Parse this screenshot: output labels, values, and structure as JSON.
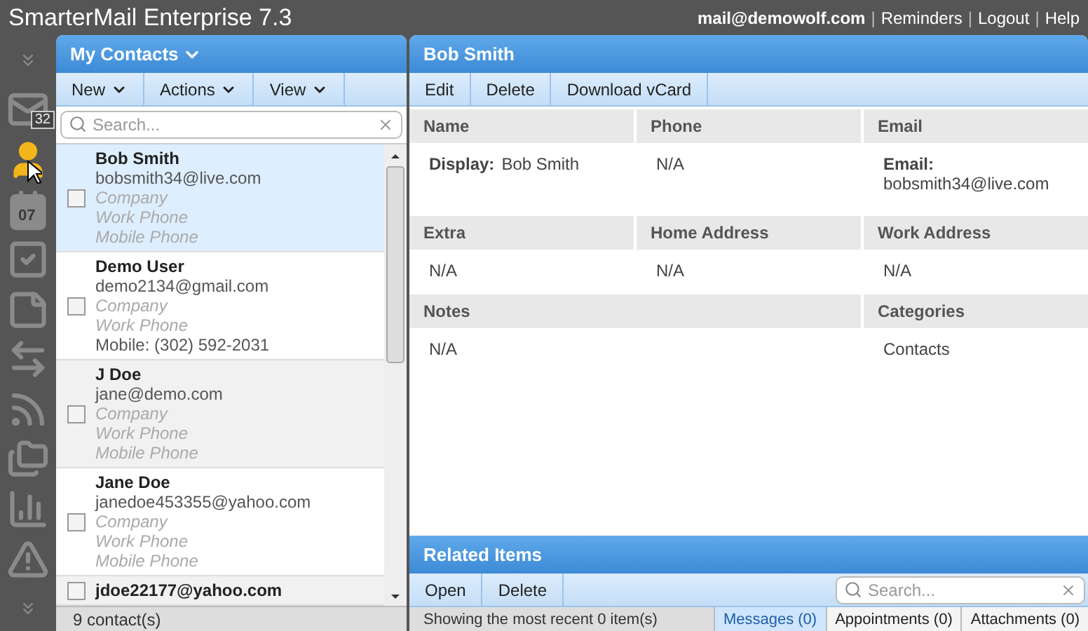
{
  "app_title": "SmarterMail Enterprise 7.3",
  "top_links": [
    {
      "text": "mail@demowolf.com",
      "kind": "account"
    },
    {
      "text": "|",
      "kind": "separator"
    },
    {
      "text": "Reminders",
      "kind": "link"
    },
    {
      "text": "|",
      "kind": "separator"
    },
    {
      "text": "Logout",
      "kind": "link"
    },
    {
      "text": "|",
      "kind": "separator"
    },
    {
      "text": "Help",
      "kind": "link"
    }
  ],
  "nav": [
    {
      "kind": "collapse"
    },
    {
      "kind": "mail",
      "badge": "32",
      "selected": false
    },
    {
      "kind": "contacts",
      "selected": true
    },
    {
      "kind": "calendar",
      "day": "07",
      "selected": false
    },
    {
      "kind": "tasks",
      "selected": false
    },
    {
      "kind": "notes",
      "selected": false
    },
    {
      "kind": "sync",
      "selected": false
    },
    {
      "kind": "feeds",
      "selected": false
    },
    {
      "kind": "files",
      "selected": false
    },
    {
      "kind": "reports",
      "selected": false
    },
    {
      "kind": "alerts",
      "selected": false
    },
    {
      "kind": "collapse"
    }
  ],
  "contacts_panel": {
    "title": "My Contacts",
    "menus": [
      "New",
      "Actions",
      "View"
    ],
    "search": {
      "placeholder": "Search..."
    },
    "contacts": [
      {
        "name": "Bob Smith",
        "selected": true,
        "checked": false,
        "lines": [
          {
            "text": "bobsmith34@live.com",
            "empty": false
          },
          {
            "text": "Company",
            "empty": true
          },
          {
            "text": "Work Phone",
            "empty": true
          },
          {
            "text": "Mobile Phone",
            "empty": true
          }
        ]
      },
      {
        "name": "Demo User",
        "selected": false,
        "checked": false,
        "lines": [
          {
            "text": "demo2134@gmail.com",
            "empty": false
          },
          {
            "text": "Company",
            "empty": true
          },
          {
            "text": "Work Phone",
            "empty": true
          },
          {
            "text": "Mobile: (302) 592-2031",
            "empty": false
          }
        ]
      },
      {
        "name": "J Doe",
        "selected": false,
        "checked": false,
        "lines": [
          {
            "text": "jane@demo.com",
            "empty": false
          },
          {
            "text": "Company",
            "empty": true
          },
          {
            "text": "Work Phone",
            "empty": true
          },
          {
            "text": "Mobile Phone",
            "empty": true
          }
        ]
      },
      {
        "name": "Jane Doe",
        "selected": false,
        "checked": false,
        "lines": [
          {
            "text": "janedoe453355@yahoo.com",
            "empty": false
          },
          {
            "text": "Company",
            "empty": true
          },
          {
            "text": "Work Phone",
            "empty": true
          },
          {
            "text": "Mobile Phone",
            "empty": true
          }
        ]
      },
      {
        "name": "jdoe22177@yahoo.com",
        "selected": false,
        "checked": false
      }
    ],
    "count": "9 contact(s)"
  },
  "detail": {
    "title": "Bob Smith",
    "actions": [
      "Edit",
      "Delete",
      "Download vCard"
    ],
    "rows": [
      [
        {
          "heading": "Name",
          "items": [
            {
              "label": "Display:",
              "value": "Bob Smith",
              "kind": "inline"
            }
          ]
        },
        {
          "heading": "Phone",
          "items": [
            {
              "value": "N/A",
              "kind": "plain"
            }
          ]
        },
        {
          "heading": "Email",
          "items": [
            {
              "label": "Email:",
              "value": "bobsmith34@live.com",
              "kind": "stacked"
            }
          ]
        }
      ],
      [
        {
          "heading": "Extra",
          "items": [
            {
              "value": "N/A",
              "kind": "plain"
            }
          ]
        },
        {
          "heading": "Home Address",
          "items": [
            {
              "value": "N/A",
              "kind": "plain"
            }
          ]
        },
        {
          "heading": "Work Address",
          "items": [
            {
              "value": "N/A",
              "kind": "plain"
            }
          ]
        }
      ],
      [
        {
          "heading": "Notes",
          "items": [
            {
              "value": "N/A",
              "kind": "plain"
            }
          ]
        },
        "",
        {
          "heading": "Categories",
          "items": [
            {
              "value": "Contacts",
              "kind": "plain"
            }
          ]
        }
      ]
    ]
  },
  "related": {
    "title": "Related Items",
    "actions": [
      "Open",
      "Delete"
    ],
    "search": {
      "placeholder": "Search..."
    },
    "status": "Showing the most recent 0 item(s)",
    "tabs": [
      {
        "label": "Messages (0)",
        "selected": true
      },
      {
        "label": "Appointments (0)",
        "selected": false
      },
      {
        "label": "Attachments (0)",
        "selected": false
      }
    ]
  }
}
